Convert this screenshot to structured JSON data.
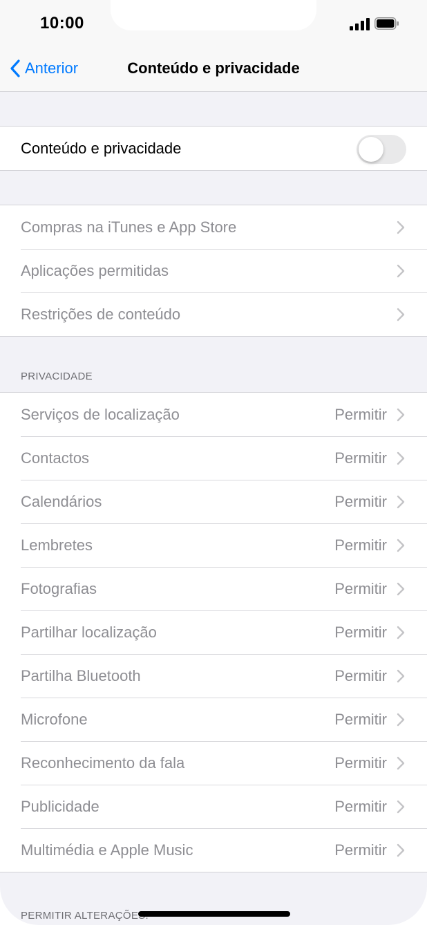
{
  "status_bar": {
    "time": "10:00"
  },
  "nav": {
    "back_label": "Anterior",
    "title": "Conteúdo e privacidade"
  },
  "main_toggle": {
    "label": "Conteúdo e privacidade",
    "enabled": false
  },
  "store_group": {
    "items": [
      {
        "label": "Compras na iTunes e App Store"
      },
      {
        "label": "Aplicações permitidas"
      },
      {
        "label": "Restrições de conteúdo"
      }
    ]
  },
  "privacy": {
    "header": "PRIVACIDADE",
    "items": [
      {
        "label": "Serviços de localização",
        "value": "Permitir"
      },
      {
        "label": "Contactos",
        "value": "Permitir"
      },
      {
        "label": "Calendários",
        "value": "Permitir"
      },
      {
        "label": "Lembretes",
        "value": "Permitir"
      },
      {
        "label": "Fotografias",
        "value": "Permitir"
      },
      {
        "label": "Partilhar localização",
        "value": "Permitir"
      },
      {
        "label": "Partilha Bluetooth",
        "value": "Permitir"
      },
      {
        "label": "Microfone",
        "value": "Permitir"
      },
      {
        "label": "Reconhecimento da fala",
        "value": "Permitir"
      },
      {
        "label": "Publicidade",
        "value": "Permitir"
      },
      {
        "label": "Multimédia e Apple Music",
        "value": "Permitir"
      }
    ]
  },
  "changes": {
    "header": "PERMITIR ALTERAÇÕES:"
  },
  "colors": {
    "accent": "#007aff",
    "disabled_text": "#8e8e93",
    "background": "#f2f2f7"
  }
}
